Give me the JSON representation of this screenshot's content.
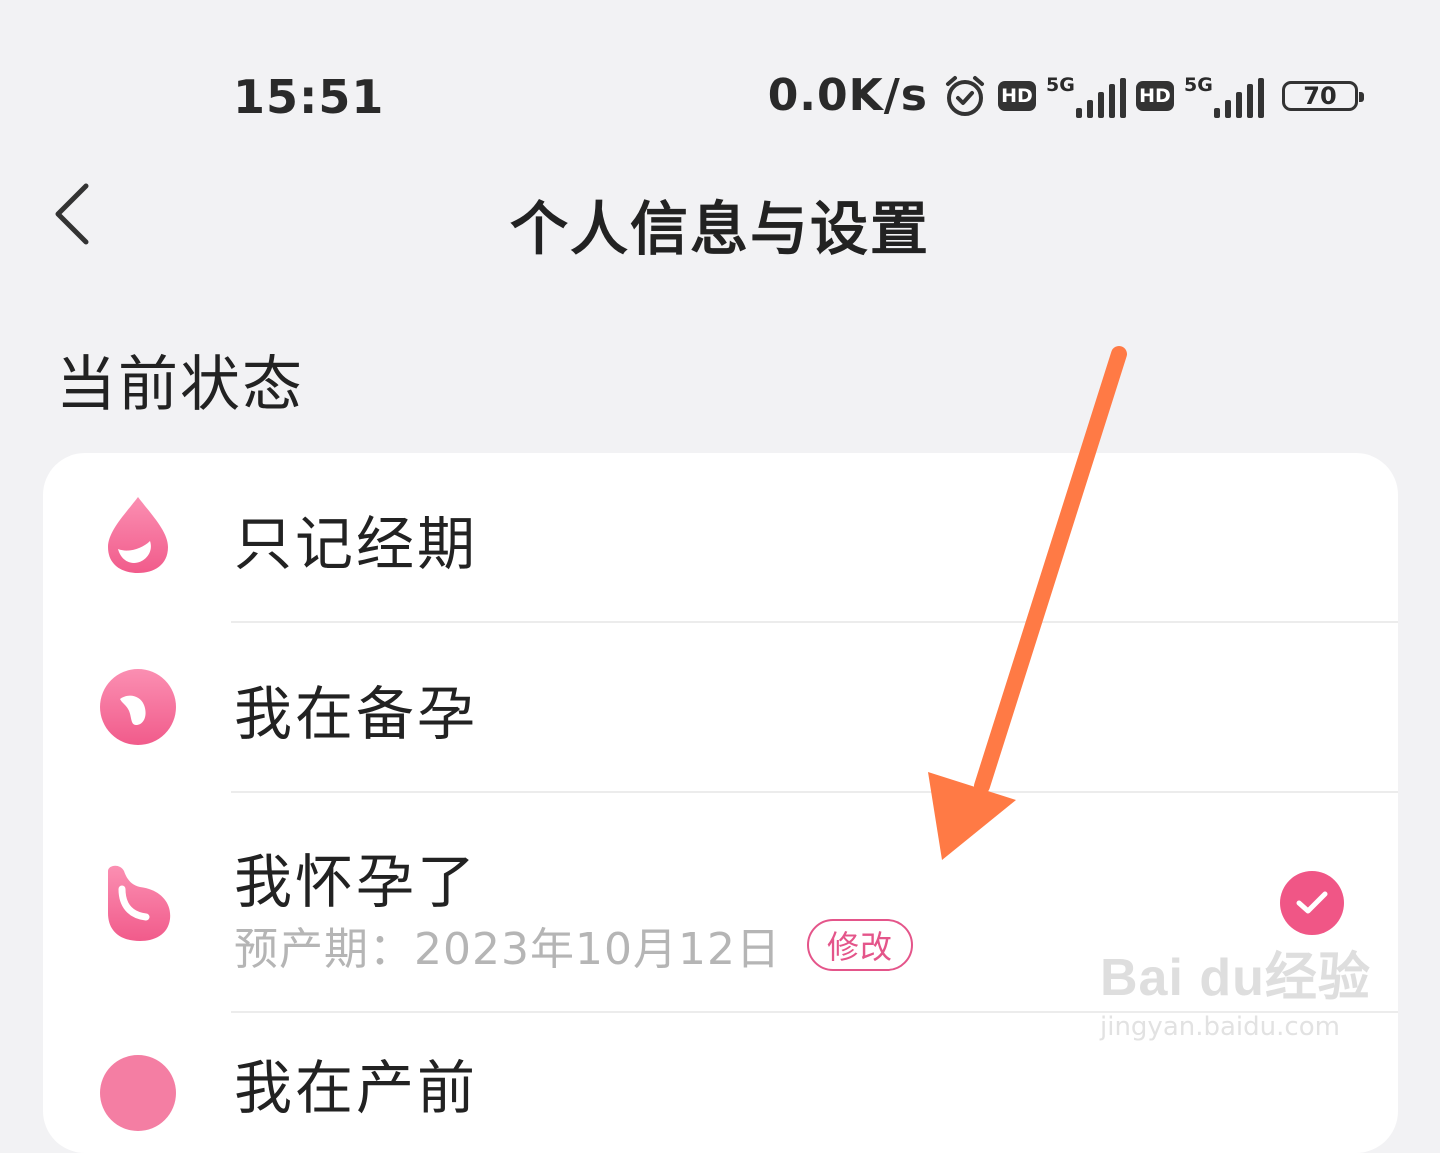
{
  "status_bar": {
    "time": "15:51",
    "net_speed": "0.0K/s",
    "hd1": "HD",
    "sim1": "5G",
    "hd2": "HD",
    "sim2": "5G",
    "battery": "70",
    "icons": [
      "alarm-icon",
      "signal-icon",
      "battery-icon"
    ]
  },
  "header": {
    "title": "个人信息与设置",
    "back_icon": "chevron-left-icon"
  },
  "section": {
    "title": "当前状态"
  },
  "status_options": [
    {
      "label": "只记经期",
      "icon": "period-drop-icon"
    },
    {
      "label": "我在备孕",
      "icon": "prep-pregnancy-icon"
    },
    {
      "label": "我怀孕了",
      "icon": "pregnant-icon",
      "due_date_text": "预产期：2023年10月12日",
      "edit_label": "修改",
      "selected": true
    },
    {
      "label": "我在产前",
      "icon": "partial-icon"
    }
  ],
  "watermark": {
    "brand": "Bai du经验",
    "url": "jingyan.baidu.com"
  },
  "colors": {
    "accent": "#f05686",
    "arrow": "#ff7a45",
    "background": "#f2f2f4"
  }
}
